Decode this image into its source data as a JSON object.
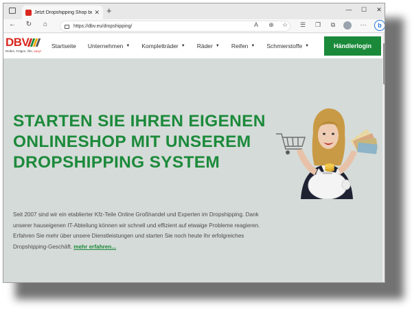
{
  "browser": {
    "tab_title": "Jetzt Dropshipping Shop beantragen",
    "tab_close": "✕",
    "new_tab": "+",
    "url": "https://dbv.eu/dropshipping/",
    "window_controls": [
      "—",
      "☐",
      "✕"
    ],
    "nav_icons": [
      "back-icon",
      "refresh-icon",
      "home-icon"
    ],
    "toolbar_icons": [
      "read-aloud-icon",
      "zoom-icon",
      "favorite-icon",
      "favorites-bar-icon",
      "collections-icon",
      "extensions-icon",
      "more-icon"
    ],
    "bing_label": "b"
  },
  "site": {
    "logo_text": "DBV",
    "logo_tagline": "Reifen, Felgen, Öle, ",
    "logo_tagline_accent": "easy!",
    "logo_colors": [
      "#d9271e",
      "#1a8a3a",
      "#f2a900",
      "#555555"
    ],
    "menu": [
      {
        "label": "Startseite",
        "has_dropdown": false
      },
      {
        "label": "Unternehmen",
        "has_dropdown": true
      },
      {
        "label": "Kompletträder",
        "has_dropdown": true
      },
      {
        "label": "Räder",
        "has_dropdown": true
      },
      {
        "label": "Reifen",
        "has_dropdown": true
      },
      {
        "label": "Schmierstoffe",
        "has_dropdown": true
      }
    ],
    "login_label": "Händlerlogin",
    "accent_color": "#1a8a3a"
  },
  "hero": {
    "title": "STARTEN SIE IHREN EIGENEN ONLINESHOP MIT UNSEREM DROPSHIPPING SYSTEM",
    "text": "Seit 2007 sind wir ein etablierter Kfz-Teile Online Großhandel und Experten im Dropshipping. Dank unserer hauseigenen IT-Abteilung können wir schnell und effizient auf etwaige Probleme reagieren. Erfahren Sie mehr über unsere Dienstleistungen und starten Sie noch heute Ihr erfolgreiches Dropshipping-Geschäft.",
    "link_label": "mehr erfahren..."
  }
}
